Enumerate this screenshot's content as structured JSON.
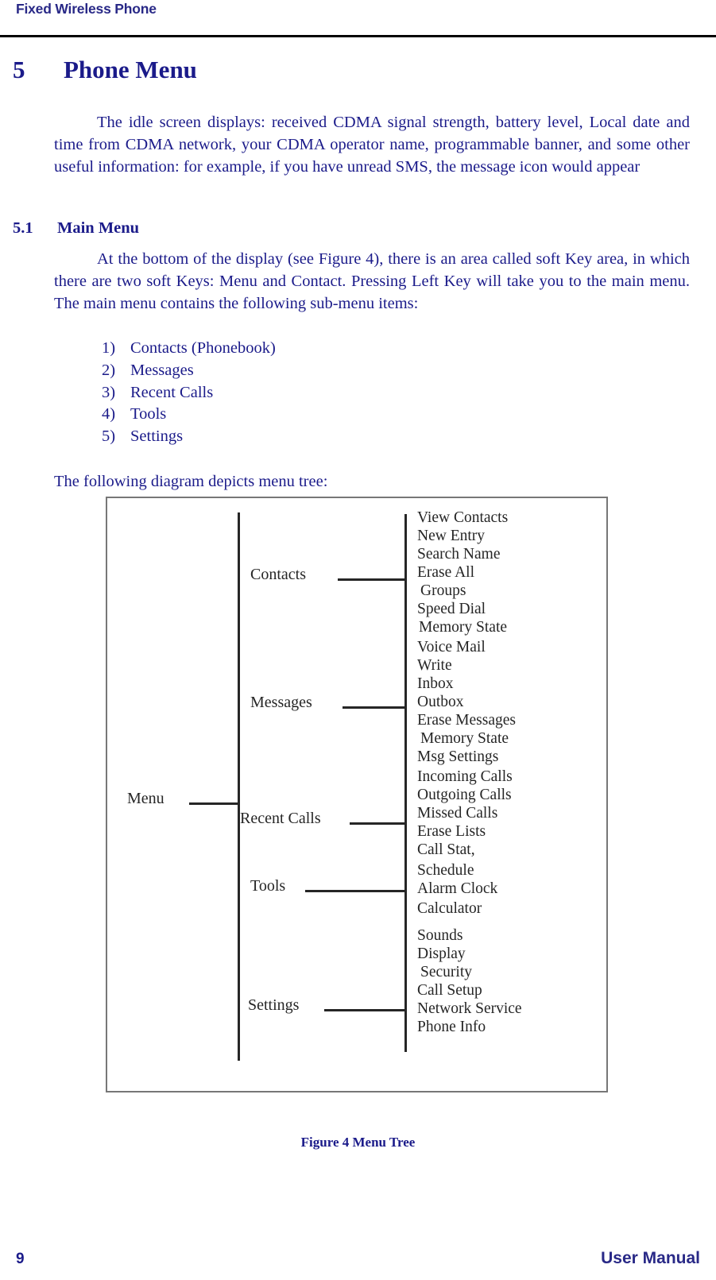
{
  "header": {
    "title": "Fixed Wireless Phone"
  },
  "chapter": {
    "number": "5",
    "title": "Phone Menu"
  },
  "intro_paragraph": "The idle screen displays: received CDMA signal strength, battery level, Local date and time from CDMA network, your CDMA operator name, programmable banner, and some other useful information: for example,  if you have unread SMS, the message icon would appear",
  "section": {
    "number": "5.1",
    "title": "Main Menu",
    "paragraph": "At the bottom of the display (see Figure 4), there is an area called soft Key area, in which there are two soft Keys: Menu and Contact.  Pressing Left Key will take you to the main menu. The main menu contains the following sub-menu items:",
    "list": [
      {
        "marker": "1)",
        "label": "Contacts (Phonebook)"
      },
      {
        "marker": "2)",
        "label": "Messages"
      },
      {
        "marker": "3)",
        "label": "Recent Calls"
      },
      {
        "marker": "4)",
        "label": "Tools"
      },
      {
        "marker": "5)",
        "label": "Settings"
      }
    ],
    "diagram_lead_in": "The following diagram depicts  menu tree:"
  },
  "figure": {
    "caption": "Figure 4 Menu Tree",
    "root_label": "Menu",
    "branches": [
      {
        "label": "Contacts",
        "items": [
          "View Contacts",
          "New Entry",
          "Search Name",
          "Erase All",
          "Groups",
          "Speed Dial",
          "Memory State"
        ]
      },
      {
        "label": "Messages",
        "items": [
          "Voice Mail",
          "Write",
          "Inbox",
          "Outbox",
          "Erase Messages",
          "Memory State",
          "Msg Settings"
        ]
      },
      {
        "label": "Recent Calls",
        "items": [
          "Incoming Calls",
          "Outgoing Calls",
          "Missed Calls",
          "Erase Lists",
          "Call Stat,"
        ]
      },
      {
        "label": "Tools",
        "items": [
          "Schedule",
          "Alarm Clock",
          "Calculator"
        ]
      },
      {
        "label": "Settings",
        "items": [
          "Sounds",
          "Display",
          "Security",
          "Call Setup",
          "Network Service",
          "Phone Info"
        ]
      }
    ]
  },
  "footer": {
    "page_number": "9",
    "document_label": "User Manual"
  },
  "colors": {
    "heading_blue": "#1b1b8a",
    "header_blue": "#292987",
    "diagram_ink": "#262626",
    "rule_black": "#000000",
    "figure_border": "#777777"
  }
}
